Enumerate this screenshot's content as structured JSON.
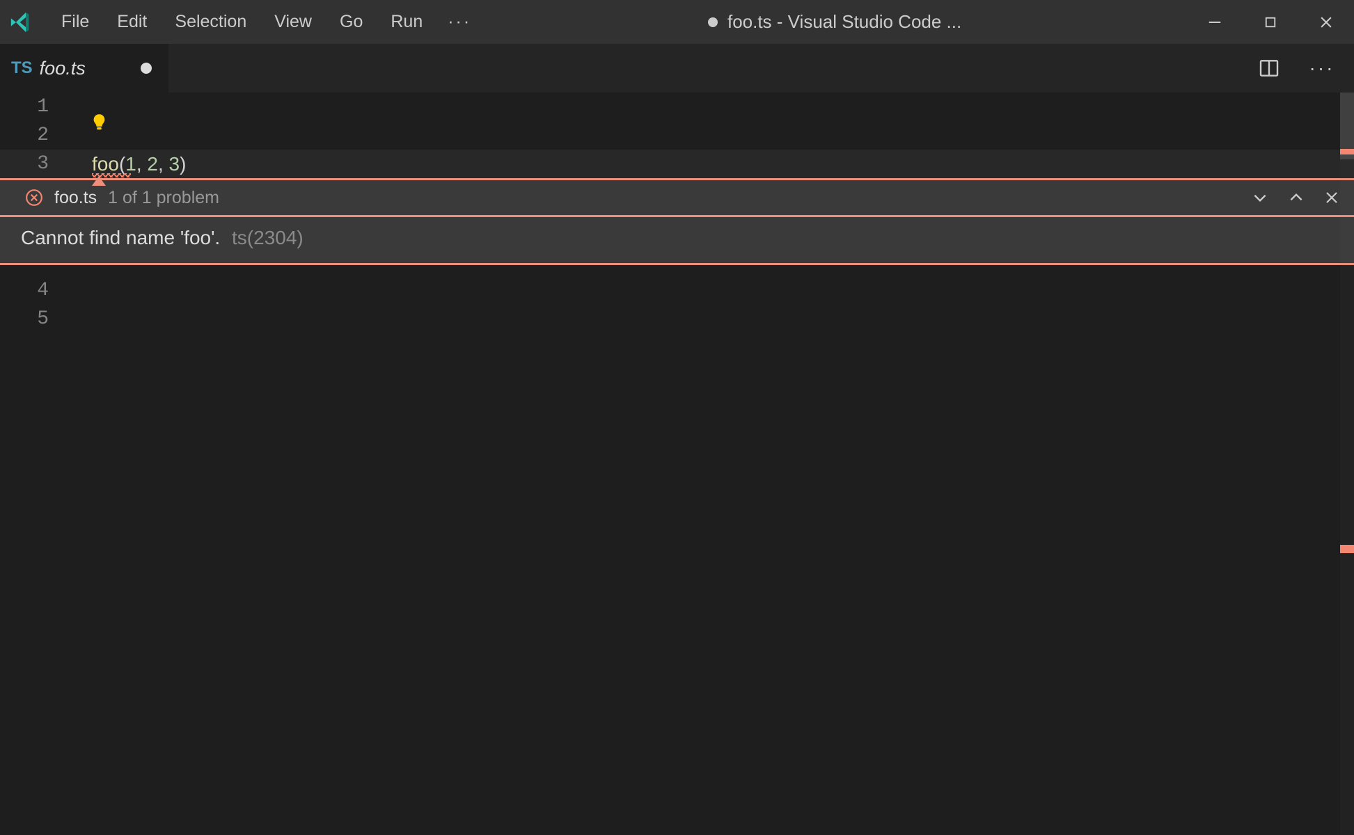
{
  "window": {
    "title_filename": "foo.ts",
    "title_suffix": " - Visual Studio Code ...",
    "is_dirty": true
  },
  "menu": {
    "items": [
      "File",
      "Edit",
      "Selection",
      "View",
      "Go",
      "Run"
    ],
    "more_glyph": "···"
  },
  "tab": {
    "language_badge": "TS",
    "filename": "foo.ts",
    "is_dirty": true
  },
  "editor_actions": {
    "more_glyph": "···"
  },
  "code": {
    "lines": [
      {
        "n": "1",
        "content": ""
      },
      {
        "n": "2",
        "content": ""
      },
      {
        "n": "3",
        "segments": {
          "fn": "foo",
          "open": "(",
          "a1": "1",
          "c1": ", ",
          "a2": "2",
          "c2": ", ",
          "a3": "3",
          "close": ")"
        },
        "has_error": true
      },
      {
        "n": "4",
        "content": ""
      },
      {
        "n": "5",
        "content": ""
      }
    ],
    "active_line_index": 2
  },
  "problem": {
    "file": "foo.ts",
    "count_label": "1 of 1 problem",
    "message": "Cannot find name 'foo'.",
    "code_label": "ts(2304)"
  },
  "colors": {
    "peek_border": "#ee8f7b",
    "error": "#f48771",
    "ts_badge": "#519aba",
    "lightbulb": "#ffcc00"
  }
}
